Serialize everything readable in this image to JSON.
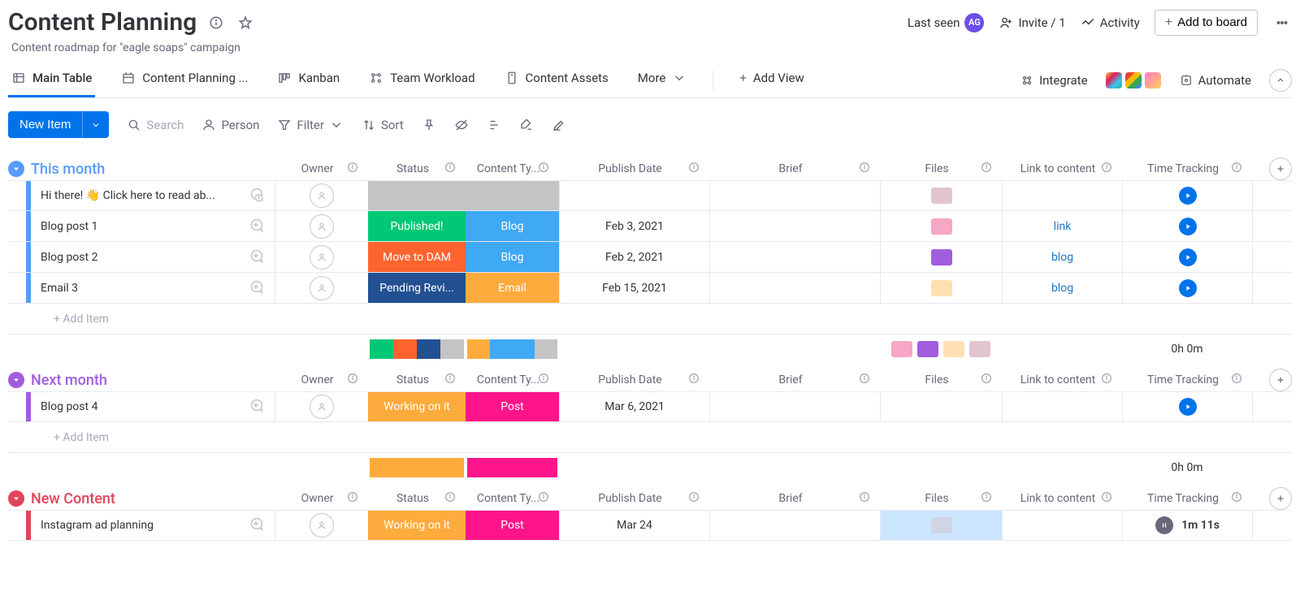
{
  "header": {
    "title": "Content Planning",
    "subtitle": "Content roadmap for \"eagle soaps\" campaign",
    "last_seen_label": "Last seen",
    "avatar_initials": "AG",
    "invite_label": "Invite / 1",
    "activity_label": "Activity",
    "add_to_board_label": "Add to board"
  },
  "tabs": {
    "items": [
      {
        "label": "Main Table",
        "active": true
      },
      {
        "label": "Content Planning ...",
        "active": false
      },
      {
        "label": "Kanban",
        "active": false
      },
      {
        "label": "Team Workload",
        "active": false
      },
      {
        "label": "Content Assets",
        "active": false
      }
    ],
    "more_label": "More",
    "add_view_label": "Add View",
    "integrate_label": "Integrate",
    "automate_label": "Automate"
  },
  "toolbar": {
    "new_item_label": "New Item",
    "search_label": "Search",
    "person_label": "Person",
    "filter_label": "Filter",
    "sort_label": "Sort"
  },
  "columns": [
    {
      "key": "owner",
      "label": "Owner"
    },
    {
      "key": "status",
      "label": "Status"
    },
    {
      "key": "content_type",
      "label": "Content Ty..."
    },
    {
      "key": "publish_date",
      "label": "Publish Date"
    },
    {
      "key": "brief",
      "label": "Brief"
    },
    {
      "key": "files",
      "label": "Files"
    },
    {
      "key": "link",
      "label": "Link to content"
    },
    {
      "key": "time_tracking",
      "label": "Time Tracking"
    }
  ],
  "add_item_label": "+ Add Item",
  "groups": [
    {
      "title": "This month",
      "color": "#579bfc",
      "rows": [
        {
          "name": "Hi there! 👋 Click here to read ab...",
          "status": "",
          "status_color": "#c4c4c4",
          "type": "",
          "type_color": "#c4c4c4",
          "date": "",
          "link": "",
          "files": [
            "#e2c4cf"
          ],
          "track": "play",
          "time": "",
          "conv": "count"
        },
        {
          "name": "Blog post 1",
          "status": "Published!",
          "status_color": "#00c875",
          "type": "Blog",
          "type_color": "#3fa9f5",
          "date": "Feb 3, 2021",
          "link": "link",
          "files": [
            "#f5a7c5"
          ],
          "track": "play",
          "time": "",
          "conv": "add"
        },
        {
          "name": "Blog post 2",
          "status": "Move to DAM",
          "status_color": "#ff642e",
          "type": "Blog",
          "type_color": "#3fa9f5",
          "date": "Feb 2, 2021",
          "link": "blog",
          "files": [
            "#a25ddc"
          ],
          "track": "play",
          "time": "",
          "conv": "add"
        },
        {
          "name": "Email 3",
          "status": "Pending Revi...",
          "status_color": "#225091",
          "type": "Email",
          "type_color": "#fdab3d",
          "date": "Feb 15, 2021",
          "link": "blog",
          "files": [
            "#ffe0b2"
          ],
          "track": "play",
          "time": "",
          "conv": "add"
        }
      ],
      "summary": {
        "status_segments": [
          "#00c875",
          "#ff642e",
          "#225091",
          "#c4c4c4"
        ],
        "type_segments": [
          "#fdab3d",
          "#3fa9f5",
          "#3fa9f5",
          "#c4c4c4"
        ],
        "files": [
          "#f5a7c5",
          "#a25ddc",
          "#ffe0b2",
          "#e2c4cf"
        ],
        "time": "0h 0m"
      }
    },
    {
      "title": "Next month",
      "color": "#a25ddc",
      "rows": [
        {
          "name": "Blog post 4",
          "status": "Working on it",
          "status_color": "#fdab3d",
          "type": "Post",
          "type_color": "#ff158a",
          "date": "Mar 6, 2021",
          "link": "",
          "files": [],
          "track": "play",
          "time": "",
          "conv": "add"
        }
      ],
      "summary": {
        "status_segments": [
          "#fdab3d"
        ],
        "type_segments": [
          "#ff158a"
        ],
        "files": [],
        "time": "0h 0m"
      }
    },
    {
      "title": "New Content",
      "color": "#e2445c",
      "rows": [
        {
          "name": "Instagram ad planning",
          "status": "Working on it",
          "status_color": "#fdab3d",
          "type": "Post",
          "type_color": "#ff158a",
          "date": "Mar 24",
          "link": "",
          "files": [
            "#d0d4e4"
          ],
          "track": "pause",
          "time": "1m 11s",
          "conv": "add",
          "files_highlight": true
        }
      ]
    }
  ]
}
